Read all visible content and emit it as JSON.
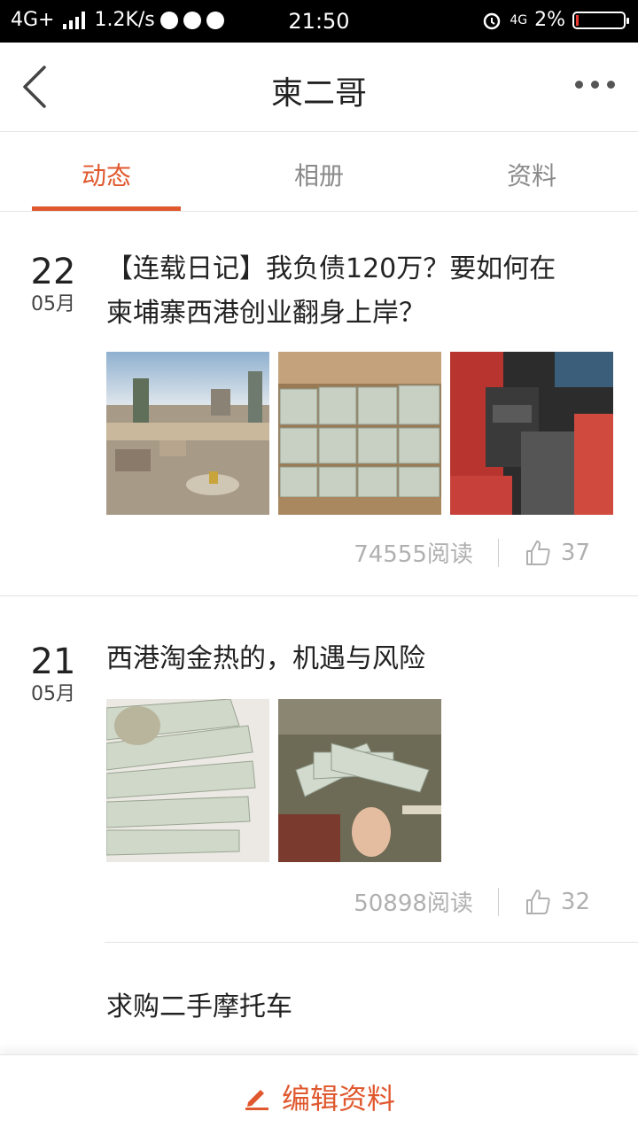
{
  "status_bar": {
    "network": "4G+",
    "speed": "1.2K/s",
    "time": "21:50",
    "network_right": "4G",
    "battery_percent": "2%"
  },
  "nav": {
    "title": "柬二哥"
  },
  "tabs": [
    {
      "label": "动态"
    },
    {
      "label": "相册"
    },
    {
      "label": "资料"
    }
  ],
  "posts": [
    {
      "day": "22",
      "month": "05月",
      "title_line1": "【连载日记】我负债120万？要如何在",
      "title_line2": "柬埔寨西港创业翻身上岸？",
      "reads": "74555阅读",
      "likes": "37"
    },
    {
      "day": "21",
      "month": "05月",
      "title_line1": "西港淘金热的，机遇与风险",
      "reads": "50898阅读",
      "likes": "32"
    },
    {
      "title_line1": "求购二手摩托车"
    }
  ],
  "bottom": {
    "edit_label": "编辑资料"
  },
  "colors": {
    "accent": "#e0582e"
  }
}
